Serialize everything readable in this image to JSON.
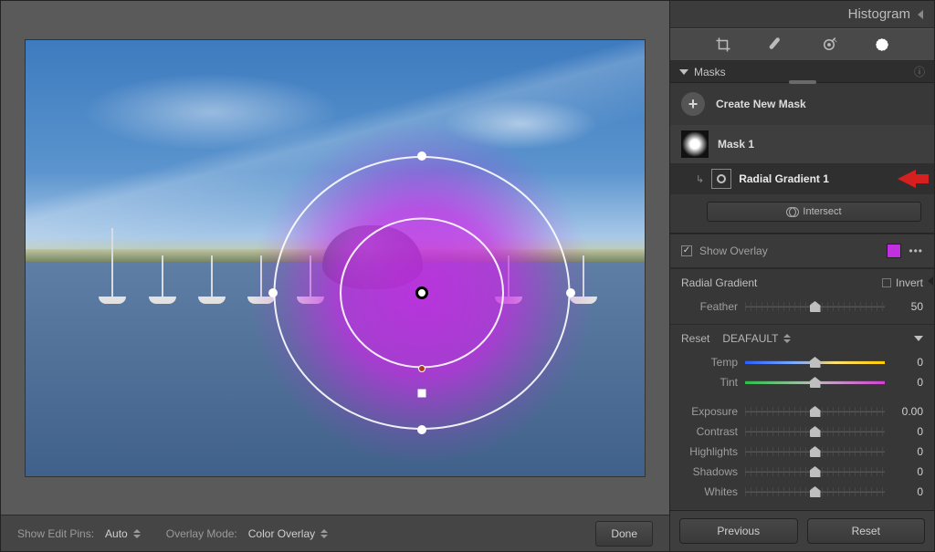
{
  "header": {
    "histogram_label": "Histogram"
  },
  "tool_row": {
    "icons": [
      "crop-icon",
      "heal-icon",
      "eye-icon",
      "radial-icon"
    ]
  },
  "masks_panel": {
    "title": "Masks",
    "create_label": "Create New Mask",
    "mask_name": "Mask 1",
    "component_name": "Radial Gradient 1",
    "intersect_label": "Intersect"
  },
  "overlay": {
    "show_label": "Show Overlay",
    "checked": true,
    "color": "#c030e0"
  },
  "radial": {
    "title": "Radial Gradient",
    "invert_label": "Invert",
    "feather_label": "Feather",
    "feather_value": "50"
  },
  "adjust": {
    "reset_label": "Reset",
    "preset_label": "DEAFAULT",
    "sliders": {
      "temp": {
        "label": "Temp",
        "value": "0"
      },
      "tint": {
        "label": "Tint",
        "value": "0"
      },
      "exposure": {
        "label": "Exposure",
        "value": "0.00"
      },
      "contrast": {
        "label": "Contrast",
        "value": "0"
      },
      "highlights": {
        "label": "Highlights",
        "value": "0"
      },
      "shadows": {
        "label": "Shadows",
        "value": "0"
      },
      "whites": {
        "label": "Whites",
        "value": "0"
      }
    }
  },
  "bottombar": {
    "pins_label": "Show Edit Pins:",
    "pins_value": "Auto",
    "overlay_mode_label": "Overlay Mode:",
    "overlay_mode_value": "Color Overlay",
    "done_label": "Done"
  },
  "side_buttons": {
    "previous": "Previous",
    "reset": "Reset"
  }
}
